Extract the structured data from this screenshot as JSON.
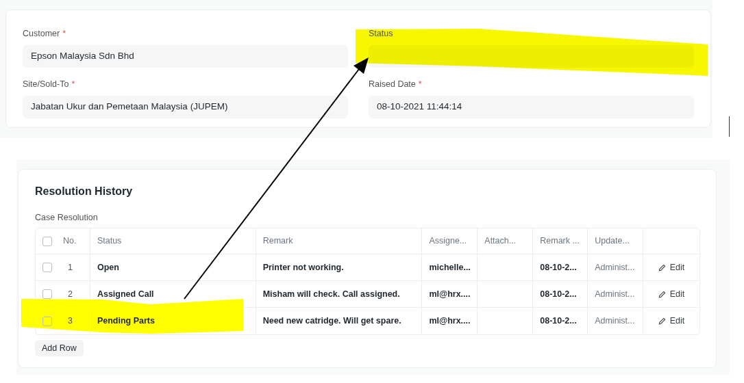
{
  "details": {
    "fields": [
      {
        "label": "Customer",
        "required_mark": "*",
        "value": "Epson Malaysia Sdn Bhd",
        "highlighted": false
      },
      {
        "label": "Status",
        "highlighted": true
      },
      {
        "label": "Site/Sold-To",
        "required_mark": "*",
        "value": "Jabatan Ukur dan Pemetaan Malaysia (JUPEM)",
        "highlighted": false
      },
      {
        "label": "Raised Date",
        "required_mark": "*",
        "value": "08-10-2021 11:44:14",
        "highlighted": false
      }
    ]
  },
  "resolution_history": {
    "title": "Resolution History",
    "table_label": "Case Resolution",
    "select_all": {
      "checked": false
    },
    "columns": [
      "No.",
      "Status",
      "Remark",
      "Assigne...",
      "Attach...",
      "Remark ...",
      "Update..."
    ],
    "rows": [
      {
        "checked": false,
        "highlighted": false,
        "cells": [
          "1",
          "Open",
          "Printer not working.",
          "michelle...",
          "",
          "08-10-2...",
          "Administ..."
        ],
        "action": "Edit"
      },
      {
        "checked": false,
        "highlighted": false,
        "cells": [
          "2",
          "Assigned Call",
          "Misham will check. Call assigned.",
          "ml@hrx....",
          "",
          "08-10-2...",
          "Administ..."
        ],
        "action": "Edit"
      },
      {
        "checked": false,
        "highlighted": true,
        "cells": [
          "3",
          "Pending Parts",
          "Need new catridge. Will get spare.",
          "ml@hrx....",
          "",
          "08-10-2...",
          "Administ..."
        ],
        "action": "Edit"
      }
    ],
    "add_button": "Add Row"
  },
  "annotations": [
    {
      "kind": "arrow"
    }
  ]
}
